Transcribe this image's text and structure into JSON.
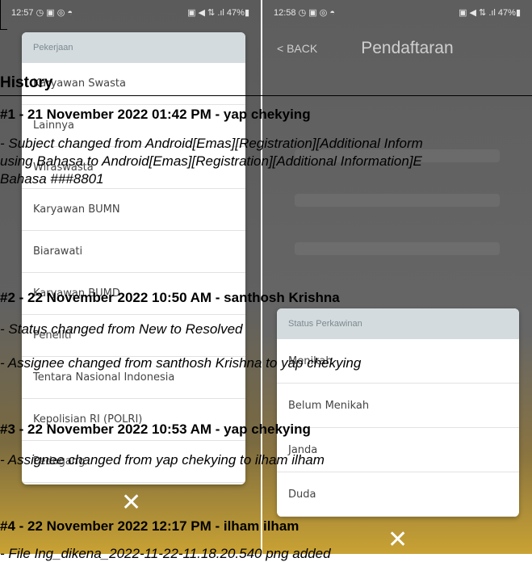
{
  "screen1": {
    "status_time": "12:57",
    "status_icons": "◷ ▣ ◎ ◓",
    "status_right": "▣ ◀ ⇅ .ıl 47%▮",
    "modal_header": "Pekerjaan",
    "items": [
      "Karyawan Swasta",
      "Lainnya",
      "Wiraswasta",
      "Karyawan BUMN",
      "Biarawati",
      "Karyawan BUMD",
      "Peneliti",
      "Tentara Nasional Indonesia",
      "Kepolisian RI (POLRI)",
      "Pedagang"
    ]
  },
  "screen2": {
    "status_time": "12:58",
    "status_icons": "◷ ▣ ◎ ◓",
    "status_right": "▣ ◀ ⇅ .ıl 47%▮",
    "back_label": "< BACK",
    "title": "Pendaftaran",
    "modal_header": "Status Perkawinan",
    "items": [
      "Menikah",
      "Belum Menikah",
      "Janda",
      "Duda"
    ]
  },
  "close_glyph": "✕",
  "history": {
    "title": "History",
    "entries": [
      {
        "header": "#1 - 21 November 2022 01:42 PM - yap chekying",
        "lines": [
          "- Subject changed from Android[Emas][Registration][Additional Inform",
          "using Bahasa to Android[Emas][Registration][Additional Information]E",
          "Bahasa ###8801"
        ]
      },
      {
        "header": "#2 - 22 November 2022 10:50 AM - santhosh Krishna",
        "lines": [
          "- Status changed from New to Resolved",
          "- Assignee changed from santhosh Krishna to yap chekying"
        ]
      },
      {
        "header": "#3 - 22 November 2022 10:53 AM - yap chekying",
        "lines": [
          "- Assignee changed from yap chekying to ilham ilham"
        ]
      },
      {
        "header": "#4 - 22 November 2022 12:17 PM - ilham ilham",
        "lines": [
          "- File Ing_dikena_2022-11-22-11.18.20.540 png added"
        ]
      }
    ]
  }
}
